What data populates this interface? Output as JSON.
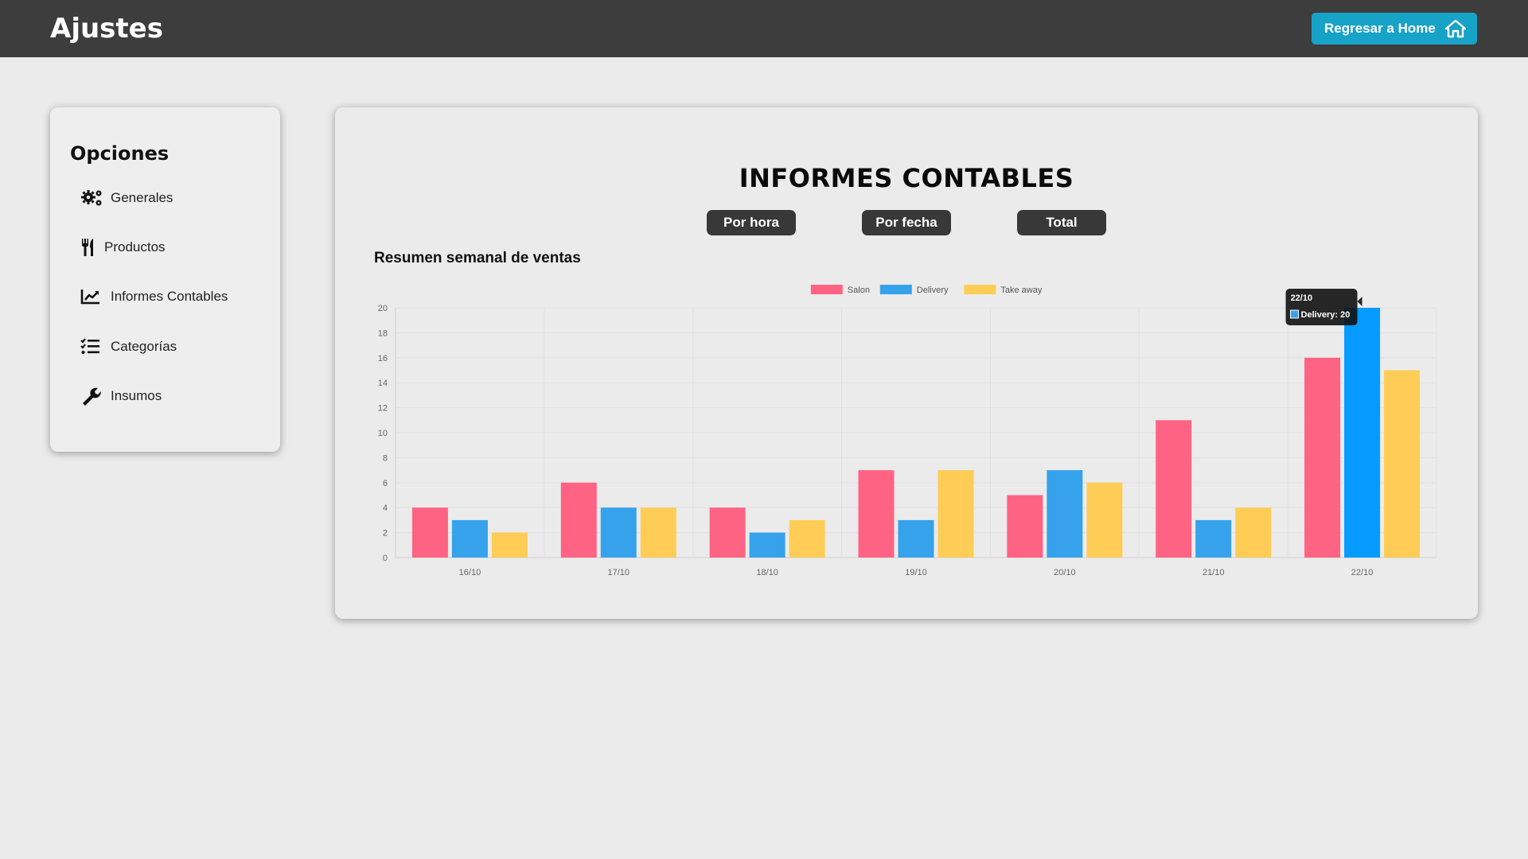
{
  "header": {
    "title": "Ajustes",
    "home_button": "Regresar a Home"
  },
  "sidebar": {
    "title": "Opciones",
    "items": [
      {
        "label": "Generales",
        "icon": "gears-icon"
      },
      {
        "label": "Productos",
        "icon": "utensils-icon"
      },
      {
        "label": "Informes Contables",
        "icon": "chart-line-icon"
      },
      {
        "label": "Categorías",
        "icon": "list-check-icon"
      },
      {
        "label": "Insumos",
        "icon": "wrench-icon"
      }
    ]
  },
  "main": {
    "title": "INFORMES CONTABLES",
    "tabs": [
      "Por hora",
      "Por fecha",
      "Total"
    ],
    "section_title": "Resumen semanal de ventas"
  },
  "chart_data": {
    "type": "bar",
    "title": "",
    "xlabel": "",
    "ylabel": "",
    "categories": [
      "16/10",
      "17/10",
      "18/10",
      "19/10",
      "20/10",
      "21/10",
      "22/10"
    ],
    "series": [
      {
        "name": "Salon",
        "color": "#ff6384",
        "values": [
          4,
          6,
          4,
          7,
          5,
          11,
          16
        ]
      },
      {
        "name": "Delivery",
        "color": "#36a2eb",
        "values": [
          3,
          4,
          2,
          3,
          7,
          3,
          20
        ]
      },
      {
        "name": "Take away",
        "color": "#ffcd56",
        "values": [
          2,
          4,
          3,
          7,
          6,
          4,
          15
        ]
      }
    ],
    "ylim": [
      0,
      20
    ],
    "yticks": [
      "0",
      "2",
      "4",
      "6",
      "8",
      "10",
      "12",
      "14",
      "16",
      "18",
      "20"
    ],
    "legend_position": "top",
    "grid": true,
    "highlight_color": "#059bff",
    "tooltip": {
      "title": "22/10",
      "text": "Delivery: 20",
      "color": "#36a2eb"
    }
  }
}
